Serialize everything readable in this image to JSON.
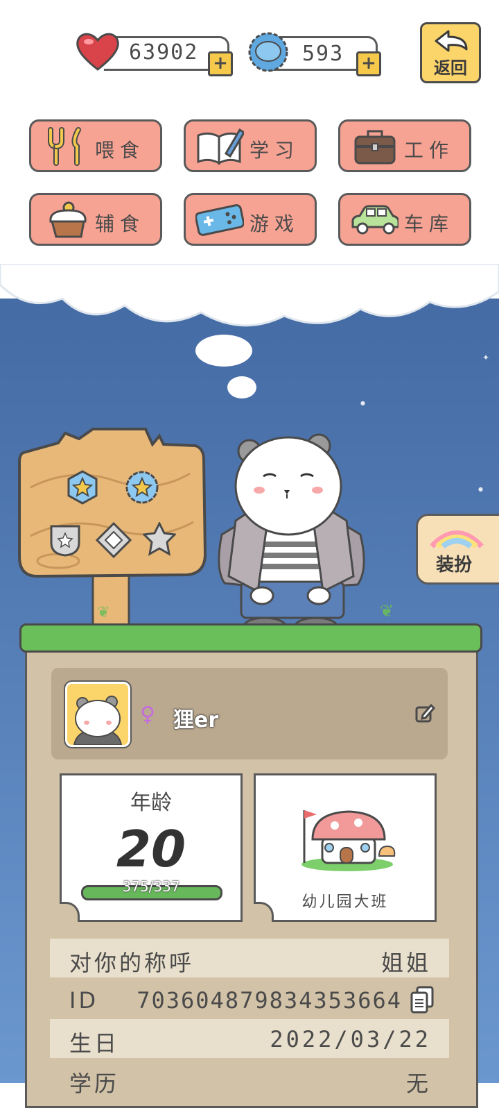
{
  "header": {
    "hearts": {
      "value": "63902",
      "icon": "heart-icon"
    },
    "gems": {
      "value": "593",
      "icon": "gem-icon"
    },
    "back_label": "返回"
  },
  "actions": [
    {
      "label": "喂食",
      "icon": "fork-knife-icon"
    },
    {
      "label": "学习",
      "icon": "book-pen-icon"
    },
    {
      "label": "工作",
      "icon": "briefcase-icon"
    },
    {
      "label": "辅食",
      "icon": "cupcake-icon"
    },
    {
      "label": "游戏",
      "icon": "gamepad-icon"
    },
    {
      "label": "车库",
      "icon": "car-icon"
    }
  ],
  "side": {
    "dress_label": "装扮"
  },
  "profile": {
    "gender_symbol": "♀",
    "name": "狸er"
  },
  "age_card": {
    "label": "年龄",
    "value": "20",
    "xp": "375/337"
  },
  "school_card": {
    "label": "幼儿园大班"
  },
  "info_rows": [
    {
      "label": "对你的称呼",
      "value": "姐姐"
    },
    {
      "label": "ID",
      "value": "70360487983435366​4"
    },
    {
      "label": "生日",
      "value": "2022/03/22"
    },
    {
      "label": "学历",
      "value": "无"
    }
  ],
  "colors": {
    "button_bg": "#f7a393",
    "accent_yellow": "#fbd46a",
    "sky": "#385d97",
    "grass": "#6bbf5a"
  }
}
